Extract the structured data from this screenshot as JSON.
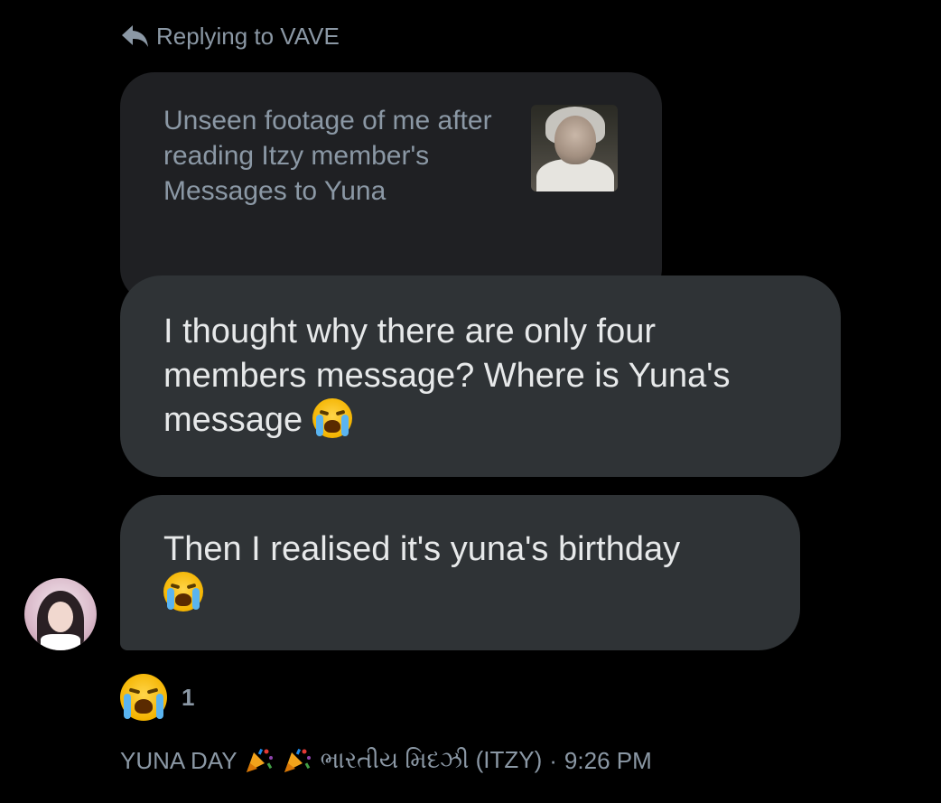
{
  "reply": {
    "icon": "reply-arrow-icon",
    "label": "Replying to VAVE"
  },
  "quoted_message": {
    "text": "Unseen footage of me after reading Itzy member's Messages to Yuna",
    "thumbnail": "crying-person-thumbnail"
  },
  "messages": [
    {
      "text": "I thought why there are only four members message? Where is Yuna's message",
      "emoji": "😭"
    },
    {
      "text": "Then I realised it's yuna's birthday",
      "emoji": "😭"
    }
  ],
  "reaction": {
    "emoji": "😭",
    "count": "1"
  },
  "meta": {
    "sender": "YUNA DAY",
    "sender_suffix": "ભારતીય મિદઝી (ITZY)",
    "separator": "·",
    "time": "9:26 PM"
  },
  "colors": {
    "background": "#000000",
    "bubble": "#2f3336",
    "quote_bubble": "#1f2023",
    "muted_text": "#8b98a5",
    "primary_text": "#e7e9ea"
  }
}
